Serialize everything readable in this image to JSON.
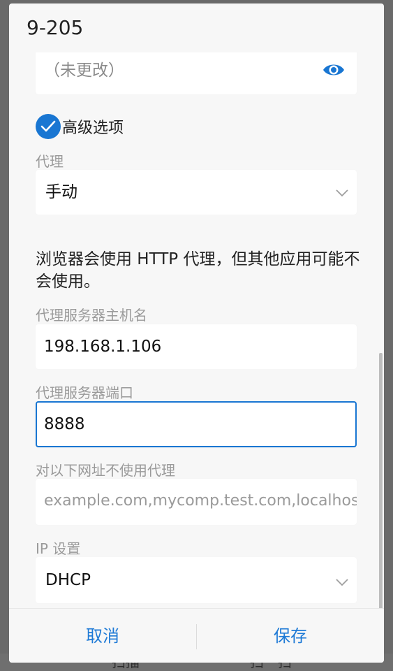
{
  "dialog": {
    "title": "9-205"
  },
  "password": {
    "value": "（未更改）",
    "toggle_icon": "eye-icon"
  },
  "advanced_options": {
    "label": "高级选项",
    "checked": true
  },
  "proxy": {
    "label": "代理",
    "selected": "手动"
  },
  "info_text": "浏览器会使用 HTTP 代理，但其他应用可能不会使用。",
  "proxy_host": {
    "label": "代理服务器主机名",
    "value": "198.168.1.106"
  },
  "proxy_port": {
    "label": "代理服务器端口",
    "value": "8888"
  },
  "bypass": {
    "label": "对以下网址不使用代理",
    "placeholder": "example.com,mycomp.test.com,localhost"
  },
  "ip_settings": {
    "label": "IP 设置",
    "selected": "DHCP"
  },
  "footer": {
    "cancel_label": "取消",
    "save_label": "保存"
  },
  "background": {
    "left_text": "扫描",
    "right_text": "扫一扫"
  },
  "colors": {
    "accent": "#1976d2",
    "button_text": "#1e7ad6",
    "dialog_bg": "#f7f7f7"
  }
}
